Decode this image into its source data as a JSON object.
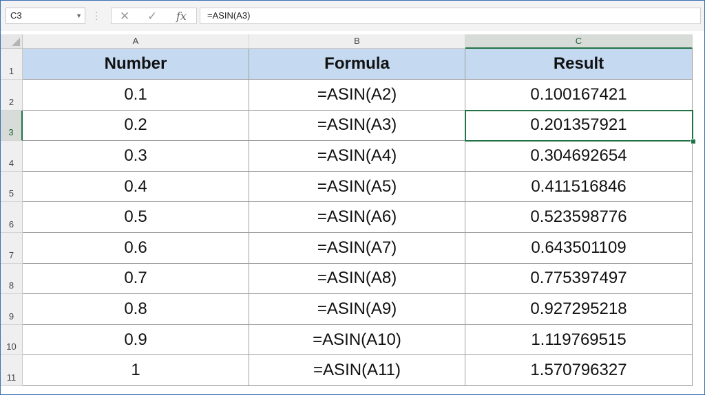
{
  "name_box": {
    "value": "C3",
    "dropdown_icon": "chevron-down-icon"
  },
  "formula_bar": {
    "cancel_icon": "close-icon",
    "enter_icon": "check-icon",
    "function_icon": "fx-icon",
    "fx_label": "fx",
    "formula": "=ASIN(A3)"
  },
  "columns": [
    "A",
    "B",
    "C"
  ],
  "selected_column": "C",
  "selected_row": 3,
  "table": {
    "headers": [
      "Number",
      "Formula",
      "Result"
    ],
    "rows": [
      {
        "row": "2",
        "number": "0.1",
        "formula": "=ASIN(A2)",
        "result": "0.100167421"
      },
      {
        "row": "3",
        "number": "0.2",
        "formula": "=ASIN(A3)",
        "result": "0.201357921"
      },
      {
        "row": "4",
        "number": "0.3",
        "formula": "=ASIN(A4)",
        "result": "0.304692654"
      },
      {
        "row": "5",
        "number": "0.4",
        "formula": "=ASIN(A5)",
        "result": "0.411516846"
      },
      {
        "row": "6",
        "number": "0.5",
        "formula": "=ASIN(A6)",
        "result": "0.523598776"
      },
      {
        "row": "7",
        "number": "0.6",
        "formula": "=ASIN(A7)",
        "result": "0.643501109"
      },
      {
        "row": "8",
        "number": "0.7",
        "formula": "=ASIN(A8)",
        "result": "0.775397497"
      },
      {
        "row": "9",
        "number": "0.8",
        "formula": "=ASIN(A9)",
        "result": "0.927295218"
      },
      {
        "row": "10",
        "number": "0.9",
        "formula": "=ASIN(A10)",
        "result": "1.119769515"
      },
      {
        "row": "11",
        "number": "1",
        "formula": "=ASIN(A11)",
        "result": "1.570796327"
      }
    ]
  },
  "header_row_label": "1",
  "colors": {
    "header_fill": "#c5d9f1",
    "selection": "#217346",
    "window_border": "#3c6fb4"
  }
}
